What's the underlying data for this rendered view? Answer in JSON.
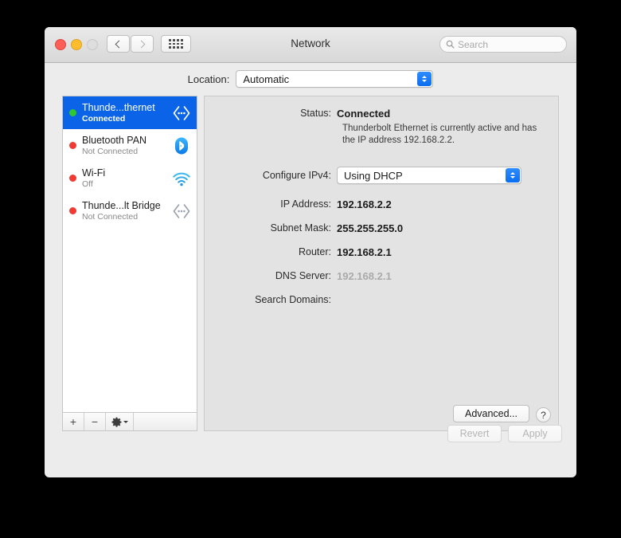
{
  "window": {
    "title": "Network",
    "traffic_lights": [
      "close",
      "minimize",
      "zoom"
    ],
    "nav": {
      "back": "back",
      "forward": "forward",
      "show_all": "show-all"
    }
  },
  "search": {
    "placeholder": "Search",
    "value": ""
  },
  "location": {
    "label": "Location:",
    "value": "Automatic"
  },
  "sidebar": {
    "services": [
      {
        "name": "Thunde...thernet",
        "state": "Connected",
        "dot": "#2fc92f",
        "icon": "thunderbolt-ethernet-icon",
        "selected": true
      },
      {
        "name": "Bluetooth PAN",
        "state": "Not Connected",
        "dot": "#f03b34",
        "icon": "bluetooth-icon",
        "selected": false
      },
      {
        "name": "Wi-Fi",
        "state": "Off",
        "dot": "#f03b34",
        "icon": "wifi-icon",
        "selected": false
      },
      {
        "name": "Thunde...lt Bridge",
        "state": "Not Connected",
        "dot": "#f03b34",
        "icon": "thunderbolt-bridge-icon",
        "selected": false
      }
    ],
    "toolbar": {
      "add": "+",
      "remove": "−",
      "gear": "gear-icon"
    }
  },
  "detail": {
    "status_label": "Status:",
    "status_value": "Connected",
    "status_description": "Thunderbolt Ethernet is currently active and has the IP address 192.168.2.2.",
    "configure_label": "Configure IPv4:",
    "configure_value": "Using DHCP",
    "fields": [
      {
        "label": "IP Address:",
        "value": "192.168.2.2",
        "dim": false
      },
      {
        "label": "Subnet Mask:",
        "value": "255.255.255.0",
        "dim": false
      },
      {
        "label": "Router:",
        "value": "192.168.2.1",
        "dim": false
      },
      {
        "label": "DNS Server:",
        "value": "192.168.2.1",
        "dim": true
      },
      {
        "label": "Search Domains:",
        "value": "",
        "dim": false
      }
    ],
    "advanced_label": "Advanced...",
    "help_label": "?"
  },
  "footer": {
    "revert_label": "Revert",
    "apply_label": "Apply"
  },
  "colors": {
    "selection_blue": "#0b64e8",
    "connected_green": "#2fc92f",
    "disconnected_red": "#f03b34",
    "window_bg": "#ececec",
    "panel_bg": "#e3e3e3"
  }
}
